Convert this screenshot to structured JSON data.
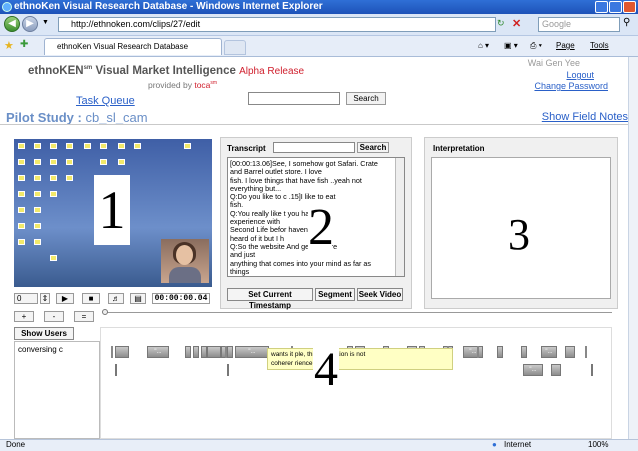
{
  "window": {
    "title": "ethnoKen Visual Research Database - Windows Internet Explorer"
  },
  "browser": {
    "url": "http://ethnoken.com/clips/27/edit",
    "search_placeholder": "Google",
    "tab_label": "ethnoKen Visual Research Database",
    "commands": [
      "Page",
      "Tools"
    ]
  },
  "header": {
    "brand": "ethnoKEN",
    "brand_sup": "sm",
    "brand_rest": " Visual Market Intelligence",
    "alpha": "Alpha Release",
    "provided_by": "provided by",
    "toca": "toca",
    "toca_sup": "sm",
    "user_name": "Wai Gen Yee",
    "logout": "Logout",
    "change_password": "Change Password",
    "task_queue": "Task Queue",
    "search_button": "Search"
  },
  "study": {
    "label": "Pilot Study :",
    "name": "cb_sl_cam",
    "show_field_notes": "Show Field Notes"
  },
  "video": {
    "overlay_number": "1",
    "rate_value": "0",
    "timecode": "00:00:00.04",
    "zoom_plus": "+",
    "zoom_minus": "-",
    "zoom_equal": "="
  },
  "transcript": {
    "label": "Transcript",
    "search_button": "Search",
    "overlay_number": "2",
    "lines": [
      "[00:00:13.06]See, I somehow got Safari.  Crate",
      "and Barrel outlet store. I love",
      "fish. I love things that have fish ..yeah not",
      "everything but...",
      "Q:Do you like to c              .15]I like to eat",
      "fish.",
      "Q:You really like t              you had an",
      "experience with",
      "Second Life befor              haven't. I've",
      "heard of it but I h",
      "Q:So the website              And get in there",
      "and just",
      "anything that comes into your mind as far as things",
      "that you see,"
    ],
    "btn_timestamp": "Set Current Timestamp",
    "btn_segment": "Segment",
    "btn_seek": "Seek Video"
  },
  "interpretation": {
    "label": "Interpretation",
    "overlay_number": "3"
  },
  "timeline": {
    "show_users": "Show Users",
    "user": "conversing c",
    "overlay_number": "4",
    "tooltip_line1": "wants it                         ple, this frustration is not",
    "tooltip_line2": "coherer                         rience",
    "seg_labels": [
      "\"...",
      "\"...",
      "\"...",
      "\"...",
      "\"...",
      "\"...",
      "\"...",
      "\"...",
      "\"..."
    ]
  },
  "status": {
    "left": "Done",
    "zone": "Internet",
    "zoom": "100%"
  }
}
